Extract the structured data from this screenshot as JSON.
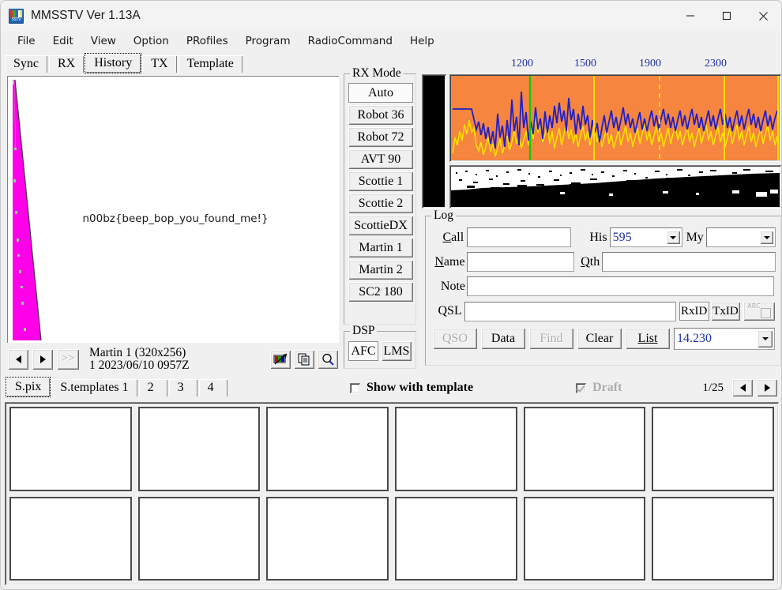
{
  "window": {
    "title": "MMSSTV Ver 1.13A",
    "icon": "sstv-app-icon",
    "controls": {
      "minimize": "minimize-icon",
      "maximize": "maximize-icon",
      "close": "close-icon"
    }
  },
  "menubar": {
    "items": [
      "File",
      "Edit",
      "View",
      "Option",
      "PRofiles",
      "Program",
      "RadioCommand",
      "Help"
    ]
  },
  "main_tabs": {
    "items": [
      "Sync",
      "RX",
      "History",
      "TX",
      "Template"
    ],
    "active": "History"
  },
  "image_panel": {
    "overlay_text": "n00bz{beep_bop_you_found_me!}",
    "wedge_color": "#ff00e8",
    "background": "#ffffff"
  },
  "history_nav": {
    "prev": "◀",
    "next": "▶",
    "fast": ">>",
    "mode_line": "Martin 1 (320x256)",
    "stamp_line": "1 2023/06/10 0957Z",
    "tools": [
      "palette-icon",
      "copy-icon",
      "zoom-icon"
    ]
  },
  "bottom_tabs": {
    "items": [
      "S.pix",
      "S.templates 1",
      "2",
      "3",
      "4"
    ],
    "active": "S.pix"
  },
  "rx_mode": {
    "title": "RX Mode",
    "selected": "Auto",
    "items": [
      "Auto",
      "Robot 36",
      "Robot 72",
      "AVT 90",
      "Scottie 1",
      "Scottie 2",
      "ScottieDX",
      "Martin 1",
      "Martin 2",
      "SC2 180"
    ]
  },
  "dsp": {
    "title": "DSP",
    "items": [
      "AFC",
      "LMS"
    ],
    "selected": "AFC"
  },
  "spectrum": {
    "ticks": [
      "1200",
      "1500",
      "1900",
      "2300"
    ],
    "tick_color": "#1c2ea8",
    "background": "#f5853f",
    "trace_colors": [
      "#2020c8",
      "#ffe000"
    ],
    "markers": [
      "#00d000",
      "#ffe000",
      "#ffe000",
      "#ffe000"
    ]
  },
  "log": {
    "title": "Log",
    "call_label": "Call",
    "call_value": "",
    "his_label": "His",
    "his_value": "595",
    "my_label": "My",
    "my_value": "",
    "name_label": "Name",
    "name_value": "",
    "qth_label": "Qth",
    "qth_value": "",
    "note_label": "Note",
    "note_value": "",
    "qsl_label": "QSL",
    "qsl_value": "",
    "rxid_label": "RxID",
    "txid_label": "TxID",
    "abc_label": "ABC",
    "buttons": [
      {
        "label": "QSO",
        "enabled": false
      },
      {
        "label": "Data",
        "enabled": true
      },
      {
        "label": "Find",
        "enabled": false
      },
      {
        "label": "Clear",
        "enabled": true
      },
      {
        "label": "List",
        "enabled": true
      }
    ],
    "frequency": "14.230"
  },
  "status_row": {
    "show_with_template_label": "Show with template",
    "show_with_template_checked": false,
    "draft_label": "Draft",
    "draft_checked": true,
    "draft_enabled": false,
    "page_counter": "1/25",
    "prev": "◀",
    "next": "▶"
  },
  "thumbnails": {
    "rows": 2,
    "cols": 6,
    "cells": [
      "",
      "",
      "",
      "",
      "",
      "",
      "",
      "",
      "",
      "",
      "",
      ""
    ]
  }
}
